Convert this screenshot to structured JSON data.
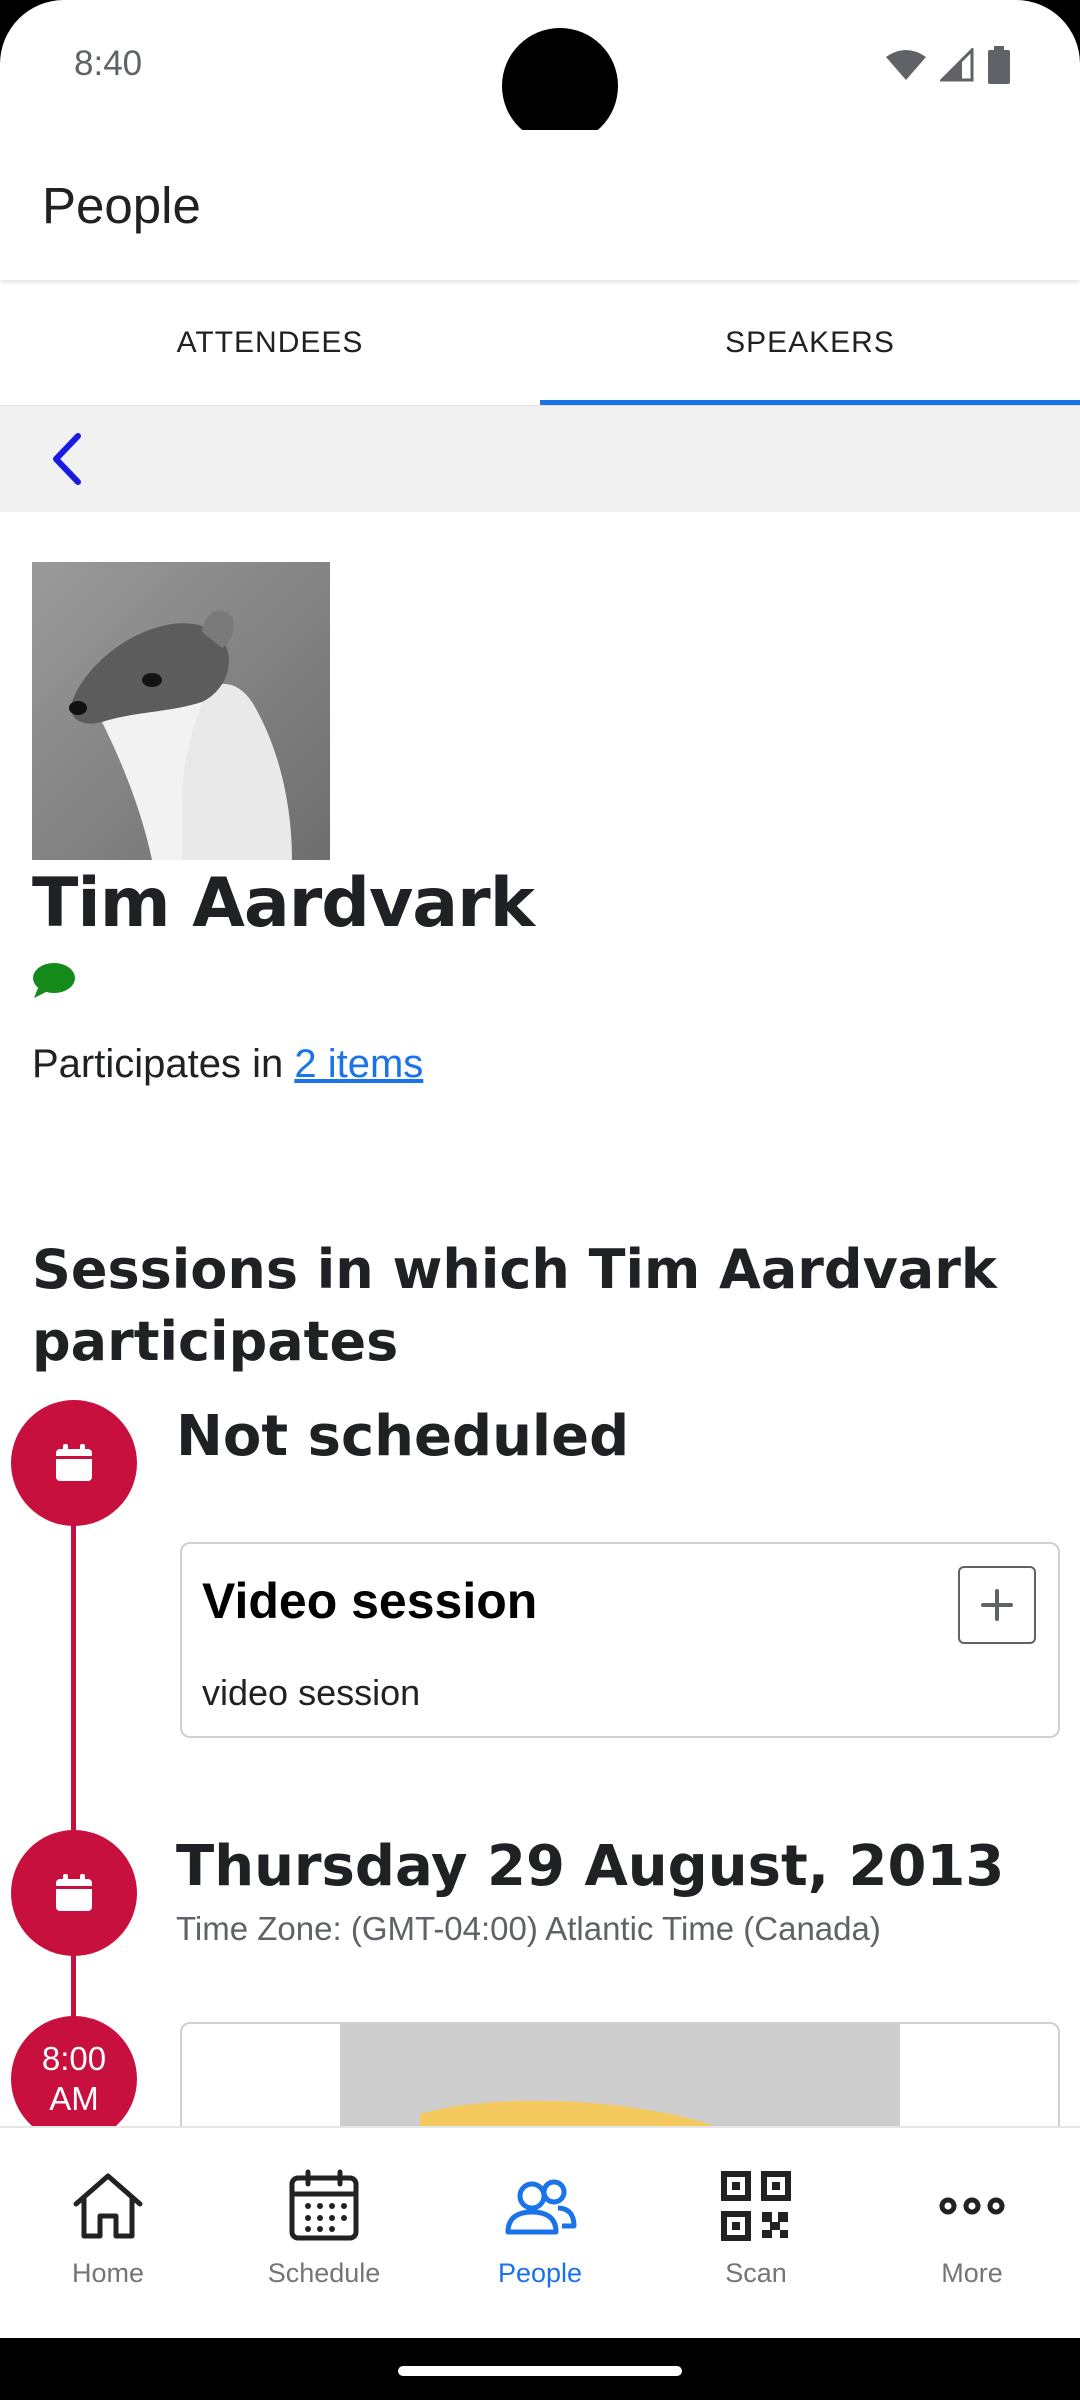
{
  "status_bar": {
    "time": "8:40"
  },
  "header": {
    "title": "People"
  },
  "tabs": [
    {
      "label": "ATTENDEES",
      "active": false
    },
    {
      "label": "SPEAKERS",
      "active": true
    }
  ],
  "profile": {
    "name": "Tim Aardvark",
    "participates_prefix": "Participates in ",
    "participates_link": "2 items"
  },
  "sessions": {
    "heading": "Sessions in which Tim Aardvark participates",
    "groups": [
      {
        "title": "Not scheduled",
        "card": {
          "title": "Video session",
          "description": "video session"
        }
      },
      {
        "title": "Thursday 29 August, 2013",
        "subtitle": "Time Zone: (GMT-04:00) Atlantic Time (Canada)",
        "time_line1": "8:00",
        "time_line2": "AM"
      }
    ]
  },
  "bottom_nav": [
    {
      "label": "Home",
      "icon": "home-icon",
      "active": false
    },
    {
      "label": "Schedule",
      "icon": "calendar-icon",
      "active": false
    },
    {
      "label": "People",
      "icon": "people-icon",
      "active": true
    },
    {
      "label": "Scan",
      "icon": "qr-code-icon",
      "active": false
    },
    {
      "label": "More",
      "icon": "more-icon",
      "active": false
    }
  ],
  "colors": {
    "accent": "#1a73e8",
    "timeline": "#c8103e",
    "chat_icon": "#138a1a"
  }
}
